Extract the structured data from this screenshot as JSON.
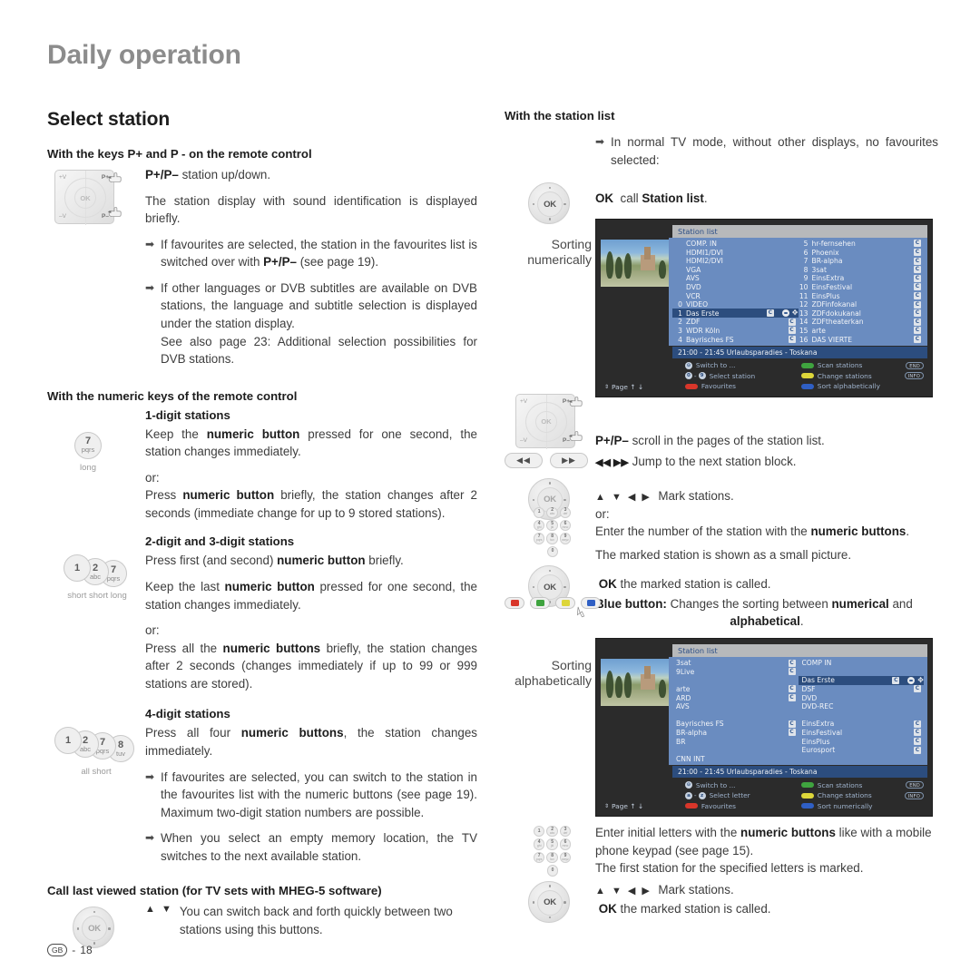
{
  "header": {
    "chapter_title": "Daily operation"
  },
  "footer": {
    "lang": "GB",
    "sep": "-",
    "page": "18"
  },
  "left": {
    "section_title": "Select station",
    "sub1": "With the keys P+ and P - on the remote control",
    "p1_bold": "P+/P–",
    "p1_rest": " station up/down.",
    "p2": "The station display with sound identification is displayed briefly.",
    "b1_a": "If favourites are selected, the station in the favourites list is switched over with ",
    "b1_bold": "P+/P–",
    "b1_b": " (see page 19).",
    "b2_a": "If other languages or DVB subtitles are available on DVB stations, the language and subtitle selection is displayed under the station display.",
    "b2_b": "See also page 23: Additional selection possibilities for DVB stations.",
    "sub2": "With the numeric keys of the remote control",
    "h_1digit": "1-digit stations",
    "key7_num": "7",
    "key7_abc": "pqrs",
    "key7_caption": "long",
    "d1_p1_a": "Keep the ",
    "d1_p1_bold": "numeric button",
    "d1_p1_b": " pressed for one second, the station changes immediately.",
    "or": "or:",
    "d1_p2_a": "Press ",
    "d1_p2_bold": "numeric button",
    "d1_p2_b": " briefly, the station changes after 2 seconds (immediate change for up to 9 stored stations).",
    "h_23digit": "2-digit and 3-digit stations",
    "keys23_caption": "short short long",
    "d23_p1_a": "Press first (and second) ",
    "d23_p1_bold": "numeric button",
    "d23_p1_b": " briefly.",
    "d23_p2_a": "Keep the last ",
    "d23_p2_bold": "numeric button",
    "d23_p2_b": " pressed for one second, the station changes immediately.",
    "d23_p3_a": "Press all the ",
    "d23_p3_bold": "numeric buttons",
    "d23_p3_b": " briefly, the station changes after 2 seconds (changes immediately if up to 99 or 999 stations are stored).",
    "h_4digit": "4-digit stations",
    "keys4_caption": "all short",
    "d4_p1_a": "Press all four ",
    "d4_p1_bold": "numeric buttons",
    "d4_p1_b": ", the station changes immediately.",
    "b3": "If favourites are selected, you can switch to the station in the favourites list with the numeric buttons (see page 19). Maximum two-digit station numbers are possible.",
    "b4": "When you select an empty memory location, the TV switches to the next available station.",
    "sub3": "Call last viewed station (for TV sets with MHEG-5 software)",
    "last_text": "You can switch back and forth quickly between two stations using this buttons."
  },
  "right": {
    "sub1": "With the station list",
    "b1": "In normal TV mode, without other displays, no favourites selected:",
    "ok_line_ok": "OK",
    "ok_line_call": "call",
    "ok_line_target": "Station list",
    "ok_line_dot": ".",
    "sorting_numerically": "Sorting\nnumerically",
    "sorting_alphabetically": "Sorting\nalphabetically",
    "p_scroll_bold": "P+/P–",
    "p_scroll_rest": " scroll in the pages of the station list.",
    "jump_glyphs": "◀◀ ▶▶",
    "jump_text": "Jump to the next station block.",
    "mark_glyphs": "▲ ▼ ◀ ▶",
    "mark_text": "Mark stations.",
    "or": "or:",
    "enter_a": "Enter the number of the station with the ",
    "enter_bold": "numeric buttons",
    "enter_b": ".",
    "small_pic": "The marked station is shown as a small picture.",
    "ok_called_bold": "OK",
    "ok_called_rest": " the marked station is called.",
    "blue_bold": "Blue button:",
    "blue_a": " Changes the sorting between ",
    "blue_num": "numerical",
    "blue_and": " and ",
    "blue_alpha": "alphabetical",
    "blue_dot": ".",
    "letters_a": "Enter initial letters with the ",
    "letters_bold": "numeric buttons",
    "letters_b": " like with a mobile phone keypad (see page 15).",
    "letters_c": "The first station for the specified letters is marked.",
    "btn_rew": "◀◀",
    "btn_ffw": "▶▶"
  },
  "tv_numeric": {
    "title": "Station list",
    "left_rows": [
      {
        "no": "",
        "name": "COMP. IN",
        "badge": false
      },
      {
        "no": "",
        "name": "HDMI1/DVI",
        "badge": false
      },
      {
        "no": "",
        "name": "HDMI2/DVI",
        "badge": false
      },
      {
        "no": "",
        "name": "VGA",
        "badge": false
      },
      {
        "no": "",
        "name": "AVS",
        "badge": false
      },
      {
        "no": "",
        "name": "DVD",
        "badge": false
      },
      {
        "no": "",
        "name": "VCR",
        "badge": false
      },
      {
        "no": "0",
        "name": "VIDEO",
        "badge": false
      },
      {
        "no": "1",
        "name": "Das Erste",
        "badge": true,
        "selected": true
      },
      {
        "no": "2",
        "name": "ZDF",
        "badge": true
      },
      {
        "no": "3",
        "name": "WDR Köln",
        "badge": true
      },
      {
        "no": "4",
        "name": "Bayrisches FS",
        "badge": true
      }
    ],
    "right_rows": [
      {
        "no": "5",
        "name": "hr-fernsehen",
        "badge": true
      },
      {
        "no": "6",
        "name": "Phoenix",
        "badge": true
      },
      {
        "no": "7",
        "name": "BR-alpha",
        "badge": true
      },
      {
        "no": "8",
        "name": "3sat",
        "badge": true
      },
      {
        "no": "9",
        "name": "EinsExtra",
        "badge": true
      },
      {
        "no": "10",
        "name": "EinsFestival",
        "badge": true
      },
      {
        "no": "11",
        "name": "EinsPlus",
        "badge": true
      },
      {
        "no": "12",
        "name": "ZDFinfokanal",
        "badge": true
      },
      {
        "no": "13",
        "name": "ZDFdokukanal",
        "badge": true
      },
      {
        "no": "14",
        "name": "ZDFtheaterkan",
        "badge": true
      },
      {
        "no": "15",
        "name": "arte",
        "badge": true
      },
      {
        "no": "16",
        "name": "DAS VIERTE",
        "badge": true
      }
    ],
    "info": "21:00 - 21:45  Urlaubsparadies - Toskana",
    "footer": {
      "page": "Page ↑ ↓",
      "switch_to": "Switch to ...",
      "select": "Select station",
      "favourites": "Favourites",
      "scan": "Scan stations",
      "change": "Change stations",
      "sort": "Sort alphabetically",
      "end": "END",
      "info_btn": "INFO",
      "num_left": "0",
      "num_right": "9"
    }
  },
  "tv_alpha": {
    "title": "Station list",
    "left_rows": [
      {
        "name": "3sat",
        "badge": true
      },
      {
        "name": "9Live",
        "badge": true
      },
      {
        "name": "",
        "badge": false,
        "empty": true
      },
      {
        "name": "arte",
        "badge": true
      },
      {
        "name": "ARD",
        "badge": true
      },
      {
        "name": "AVS",
        "badge": false
      },
      {
        "name": "",
        "badge": false,
        "empty": true
      },
      {
        "name": "Bayrisches FS",
        "badge": true
      },
      {
        "name": "BR-alpha",
        "badge": true
      },
      {
        "name": "BR",
        "badge": false
      },
      {
        "name": "",
        "badge": false,
        "empty": true
      },
      {
        "name": "CNN INT",
        "badge": false
      }
    ],
    "right_rows": [
      {
        "name": "COMP IN",
        "badge": false
      },
      {
        "name": "",
        "badge": false,
        "empty": true
      },
      {
        "name": "Das Erste",
        "badge": true,
        "selected": true
      },
      {
        "name": "DSF",
        "badge": true
      },
      {
        "name": "DVD",
        "badge": false
      },
      {
        "name": "DVD-REC",
        "badge": false
      },
      {
        "name": "",
        "badge": false,
        "empty": true
      },
      {
        "name": "EinsExtra",
        "badge": true
      },
      {
        "name": "EinsFestival",
        "badge": true
      },
      {
        "name": "EinsPlus",
        "badge": true
      },
      {
        "name": "Eurosport",
        "badge": true
      },
      {
        "name": "",
        "badge": false,
        "empty": true
      }
    ],
    "info": "21:00 - 21:45  Urlaubsparadies - Toskana",
    "footer": {
      "page": "Page ↑ ↓",
      "switch_to": "Switch to ...",
      "select": "Select letter",
      "favourites": "Favourites",
      "scan": "Scan stations",
      "change": "Change stations",
      "sort": "Sort numerically",
      "end": "END",
      "info_btn": "INFO",
      "num_left": "a",
      "num_right": "z"
    }
  },
  "keys": {
    "k1": {
      "num": "1",
      "abc": ""
    },
    "k2": {
      "num": "2",
      "abc": "abc"
    },
    "k7": {
      "num": "7",
      "abc": "pqrs"
    },
    "k8": {
      "num": "8",
      "abc": "tuv"
    }
  },
  "colors": {
    "heading_gray": "#8c8c8c",
    "tv_list_blue": "#6a8cc0",
    "tv_sel_blue": "#2c4d7e",
    "btn_red": "#d8362a",
    "btn_green": "#3fa33f",
    "btn_yellow": "#ddd63a",
    "btn_blue": "#2f5fc4"
  }
}
